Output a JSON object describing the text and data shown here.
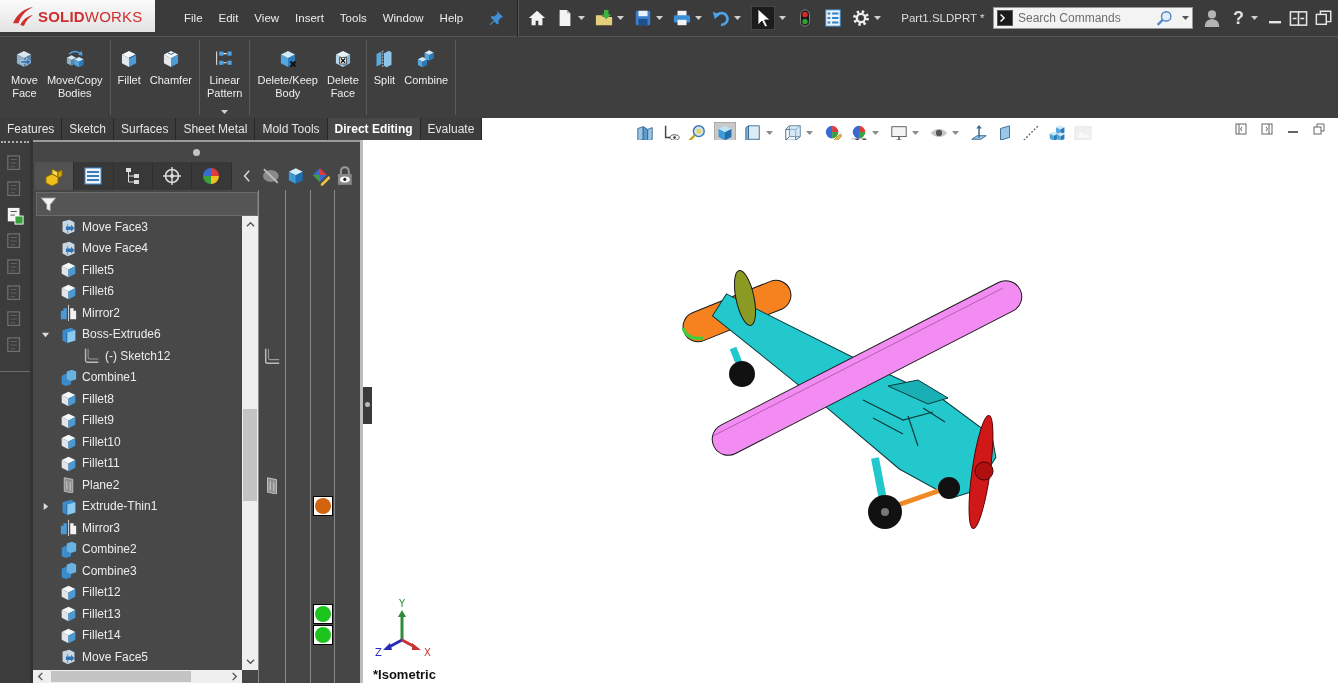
{
  "logo": "**SOLID**WORKS",
  "menu": [
    "File",
    "Edit",
    "View",
    "Insert",
    "Tools",
    "Window",
    "Help"
  ],
  "quick_access": [
    {
      "pressed": false,
      "dropdown": false
    },
    {
      "pressed": false,
      "dropdown": true
    },
    {
      "pressed": false,
      "dropdown": true
    },
    {
      "pressed": false,
      "dropdown": true
    },
    {
      "pressed": false,
      "dropdown": true
    },
    {
      "pressed": false,
      "dropdown": true
    },
    {
      "pressed": true,
      "dropdown": true
    },
    {
      "pressed": false,
      "dropdown": false
    },
    {
      "pressed": false,
      "dropdown": false
    },
    {
      "pressed": false,
      "dropdown": true
    }
  ],
  "document_title": "Part1.SLDPRT *",
  "search": {
    "placeholder": "Search Commands"
  },
  "help": {
    "label": "?",
    "dropdown": true
  },
  "ribbon": [
    [
      {
        "label": "Move Face",
        "dropdown": false
      },
      {
        "label": "Move/Copy Bodies",
        "dropdown": false
      }
    ],
    [
      {
        "label": "Fillet",
        "dropdown": false
      },
      {
        "label": "Chamfer",
        "dropdown": false
      }
    ],
    [
      {
        "label": "Linear Pattern",
        "dropdown": true
      }
    ],
    [
      {
        "label": "Delete/Keep Body",
        "dropdown": false
      },
      {
        "label": "Delete Face",
        "dropdown": false
      }
    ],
    [
      {
        "label": "Split",
        "dropdown": false
      },
      {
        "label": "Combine",
        "dropdown": false
      }
    ]
  ],
  "command_tabs": [
    {
      "label": "Features",
      "selected": false
    },
    {
      "label": "Sketch",
      "selected": false
    },
    {
      "label": "Surfaces",
      "selected": false
    },
    {
      "label": "Sheet Metal",
      "selected": false
    },
    {
      "label": "Mold Tools",
      "selected": false
    },
    {
      "label": "Direct Editing",
      "selected": true
    },
    {
      "label": "Evaluate",
      "selected": false
    }
  ],
  "view_toolbar": [
    {
      "pressed": false,
      "dropdown": false,
      "disabled": false
    },
    {
      "pressed": false,
      "dropdown": false,
      "disabled": false
    },
    {
      "pressed": false,
      "dropdown": false,
      "disabled": false
    },
    {
      "pressed": true,
      "dropdown": false,
      "disabled": false
    },
    {
      "pressed": false,
      "dropdown": true,
      "disabled": false
    },
    {
      "pressed": false,
      "dropdown": true,
      "disabled": false
    },
    {
      "pressed": false,
      "dropdown": false,
      "disabled": false
    },
    {
      "pressed": false,
      "dropdown": true,
      "disabled": false
    },
    {
      "pressed": false,
      "dropdown": true,
      "disabled": false
    },
    {
      "pressed": false,
      "dropdown": true,
      "disabled": false
    },
    {
      "pressed": false,
      "dropdown": false,
      "disabled": false
    },
    {
      "pressed": false,
      "dropdown": false,
      "disabled": false
    },
    {
      "pressed": false,
      "dropdown": false,
      "disabled": false
    },
    {
      "pressed": false,
      "dropdown": false,
      "disabled": false
    },
    {
      "pressed": false,
      "dropdown": false,
      "disabled": true
    }
  ],
  "task_pane": [
    {
      "active": false
    },
    {
      "active": false
    },
    {
      "active": true
    },
    {
      "active": false
    },
    {
      "active": false
    },
    {
      "active": false
    },
    {
      "active": false
    },
    {
      "active": false
    }
  ],
  "feature_tree": {
    "tabs": [
      {
        "selected": true
      },
      {
        "selected": false
      },
      {
        "selected": false
      },
      {
        "selected": false
      },
      {
        "selected": false
      }
    ],
    "items": [
      {
        "label": "Move Face3",
        "kind": "move-face"
      },
      {
        "label": "Move Face4",
        "kind": "move-face"
      },
      {
        "label": "Fillet5",
        "kind": "fillet"
      },
      {
        "label": "Fillet6",
        "kind": "fillet"
      },
      {
        "label": "Mirror2",
        "kind": "mirror"
      },
      {
        "label": "Boss-Extrude6",
        "kind": "extrude",
        "expanded": true,
        "children": [
          {
            "label": "(-) Sketch12",
            "kind": "sketch",
            "display_icon": true
          }
        ]
      },
      {
        "label": "Combine1",
        "kind": "combine"
      },
      {
        "label": "Fillet8",
        "kind": "fillet"
      },
      {
        "label": "Fillet9",
        "kind": "fillet"
      },
      {
        "label": "Fillet10",
        "kind": "fillet"
      },
      {
        "label": "Fillet11",
        "kind": "fillet"
      },
      {
        "label": "Plane2",
        "kind": "plane",
        "display_icon": true
      },
      {
        "label": "Extrude-Thin1",
        "kind": "extrude",
        "expanded": false,
        "color": "#d2640f"
      },
      {
        "label": "Mirror3",
        "kind": "mirror"
      },
      {
        "label": "Combine2",
        "kind": "combine"
      },
      {
        "label": "Combine3",
        "kind": "combine"
      },
      {
        "label": "Fillet12",
        "kind": "fillet"
      },
      {
        "label": "Fillet13",
        "kind": "fillet",
        "color": "#1ec41e"
      },
      {
        "label": "Fillet14",
        "kind": "fillet",
        "color": "#1ec41e"
      },
      {
        "label": "Move Face5",
        "kind": "move-face"
      }
    ]
  },
  "viewport": {
    "triad": [
      {
        "label": "Y",
        "color": "#2e8b3a"
      },
      {
        "label": "Z",
        "color": "#2a2ab8"
      },
      {
        "label": "X",
        "color": "#c83232"
      }
    ],
    "view_name": "*Isometric"
  }
}
